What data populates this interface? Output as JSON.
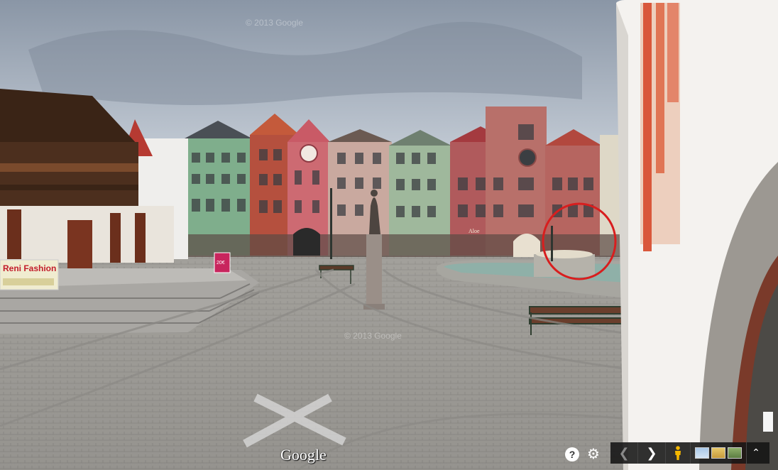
{
  "watermarks": {
    "top": "© 2013 Google",
    "middle": "© 2013 Google"
  },
  "brand": {
    "logo": "Google"
  },
  "signs": {
    "shop": "Reni Fashion",
    "board": "20€",
    "storefront": "Aloe"
  },
  "controls": {
    "help_label": "?",
    "settings_icon": "gear-icon",
    "prev_icon": "chevron-left-icon",
    "next_icon": "chevron-right-icon",
    "pegman_icon": "pegman-icon",
    "expand_icon": "chevron-up-icon"
  },
  "colors": {
    "highlight_circle": "#d81e1e",
    "pegman": "#f5b800",
    "control_bg": "#141414"
  }
}
